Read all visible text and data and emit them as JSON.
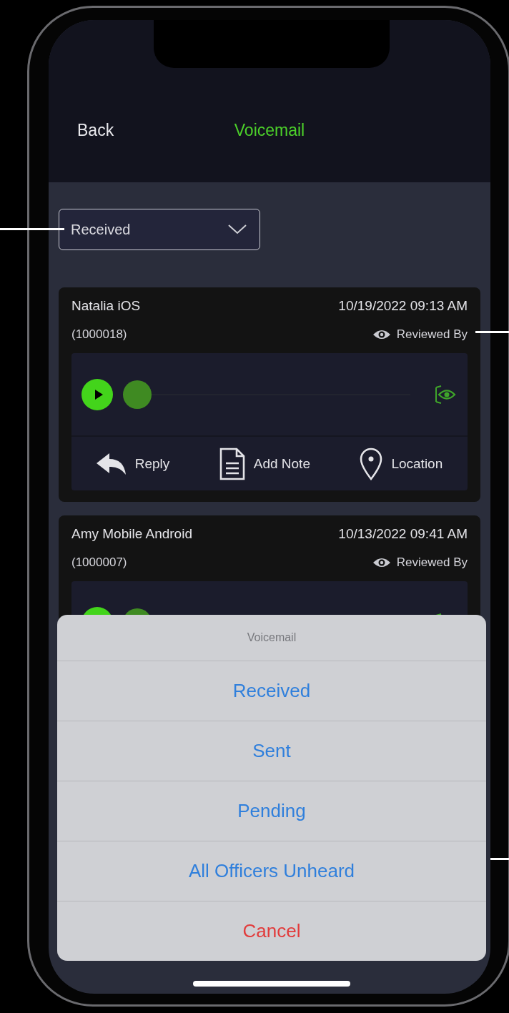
{
  "header": {
    "back": "Back",
    "title": "Voicemail"
  },
  "filter": {
    "value": "Received"
  },
  "voicemails": [
    {
      "name": "Natalia iOS",
      "date": "10/19/2022 09:13 AM",
      "number": "(1000018)",
      "reviewed": "Reviewed By",
      "level": 0,
      "actions": [
        {
          "kind": "reply",
          "label": "Reply"
        },
        {
          "kind": "note",
          "label": "Add Note"
        },
        {
          "kind": "location",
          "label": "Location"
        }
      ]
    },
    {
      "name": "Amy Mobile Android",
      "date": "10/13/2022 09:41 AM",
      "number": "(1000007)",
      "reviewed": "Reviewed By",
      "level": 0
    }
  ],
  "sheet": {
    "title": "Voicemail",
    "options": [
      {
        "label": "Received",
        "kind": "option"
      },
      {
        "label": "Sent",
        "kind": "option"
      },
      {
        "label": "Pending",
        "kind": "option"
      },
      {
        "label": "All Officers Unheard",
        "kind": "option"
      },
      {
        "label": "Cancel",
        "kind": "cancel"
      }
    ]
  }
}
